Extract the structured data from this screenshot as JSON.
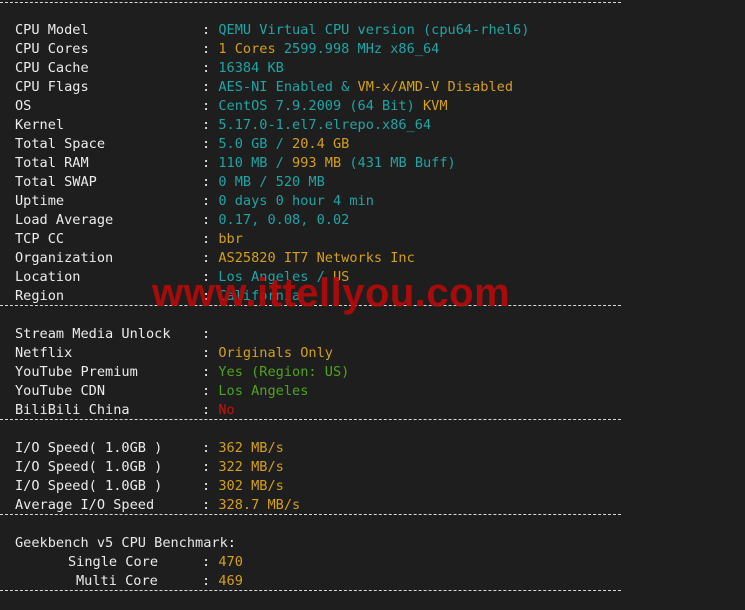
{
  "system": [
    {
      "label": "CPU Model",
      "parts": [
        {
          "t": "QEMU Virtual CPU version (cpu64-rhel6)",
          "c": "c"
        }
      ]
    },
    {
      "label": "CPU Cores",
      "parts": [
        {
          "t": "1 Cores ",
          "c": "y"
        },
        {
          "t": "2599.998 MHz x86_64",
          "c": "c"
        }
      ]
    },
    {
      "label": "CPU Cache",
      "parts": [
        {
          "t": "16384 KB",
          "c": "c"
        }
      ]
    },
    {
      "label": "CPU Flags",
      "parts": [
        {
          "t": "AES-NI Enabled & ",
          "c": "c"
        },
        {
          "t": "VM-x/AMD-V Disabled",
          "c": "y"
        }
      ]
    },
    {
      "label": "OS",
      "parts": [
        {
          "t": "CentOS 7.9.2009 (64 Bit) ",
          "c": "c"
        },
        {
          "t": "KVM",
          "c": "y"
        }
      ]
    },
    {
      "label": "Kernel",
      "parts": [
        {
          "t": "5.17.0-1.el7.elrepo.x86_64",
          "c": "c"
        }
      ]
    },
    {
      "label": "Total Space",
      "parts": [
        {
          "t": "5.0 GB / ",
          "c": "c"
        },
        {
          "t": "20.4 GB",
          "c": "y"
        }
      ]
    },
    {
      "label": "Total RAM",
      "parts": [
        {
          "t": "110 MB / ",
          "c": "c"
        },
        {
          "t": "993 MB",
          "c": "y"
        },
        {
          "t": " (431 MB Buff)",
          "c": "c"
        }
      ]
    },
    {
      "label": "Total SWAP",
      "parts": [
        {
          "t": "0 MB / 520 MB",
          "c": "c"
        }
      ]
    },
    {
      "label": "Uptime",
      "parts": [
        {
          "t": "0 days 0 hour 4 min",
          "c": "c"
        }
      ]
    },
    {
      "label": "Load Average",
      "parts": [
        {
          "t": "0.17, 0.08, 0.02",
          "c": "c"
        }
      ]
    },
    {
      "label": "TCP CC",
      "parts": [
        {
          "t": "bbr",
          "c": "y"
        }
      ]
    },
    {
      "label": "Organization",
      "parts": [
        {
          "t": "AS25820 IT7 Networks Inc",
          "c": "y"
        }
      ]
    },
    {
      "label": "Location",
      "parts": [
        {
          "t": "Los Angeles / ",
          "c": "c"
        },
        {
          "t": "US",
          "c": "y"
        }
      ]
    },
    {
      "label": "Region",
      "parts": [
        {
          "t": "California",
          "c": "c"
        }
      ]
    }
  ],
  "stream": [
    {
      "label": "Stream Media Unlock",
      "parts": []
    },
    {
      "label": "Netflix",
      "parts": [
        {
          "t": "Originals Only",
          "c": "y"
        }
      ]
    },
    {
      "label": "YouTube Premium",
      "parts": [
        {
          "t": "Yes (Region: US)",
          "c": "g"
        }
      ]
    },
    {
      "label": "YouTube CDN",
      "parts": [
        {
          "t": "Los Angeles",
          "c": "g"
        }
      ]
    },
    {
      "label": "BiliBili China",
      "parts": [
        {
          "t": "No",
          "c": "r"
        }
      ]
    }
  ],
  "io": [
    {
      "label": "I/O Speed( 1.0GB )",
      "parts": [
        {
          "t": "362 MB/s",
          "c": "y"
        }
      ]
    },
    {
      "label": "I/O Speed( 1.0GB )",
      "parts": [
        {
          "t": "322 MB/s",
          "c": "y"
        }
      ]
    },
    {
      "label": "I/O Speed( 1.0GB )",
      "parts": [
        {
          "t": "302 MB/s",
          "c": "y"
        }
      ]
    },
    {
      "label": "Average I/O Speed",
      "parts": [
        {
          "t": "328.7 MB/s",
          "c": "y"
        }
      ]
    }
  ],
  "geekbench": {
    "title": "Geekbench v5 CPU Benchmark:",
    "rows": [
      {
        "label": "Single Core",
        "value": "470"
      },
      {
        "label": "Multi Core",
        "value": "469"
      }
    ]
  },
  "colon": ": ",
  "watermark": "www.ittellyou.com",
  "colors": {
    "cyan": "#1fa5a5",
    "yellow": "#d4a017",
    "green": "#4ea51a",
    "red": "#c81010",
    "background": "#1e1e1e"
  }
}
